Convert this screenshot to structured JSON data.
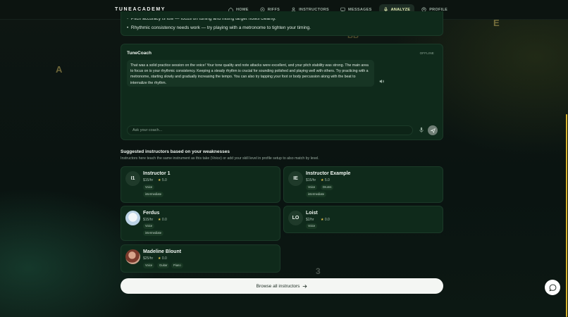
{
  "app": {
    "logo": "TUNEACADEMY"
  },
  "nav": {
    "items": [
      {
        "label": "HOME",
        "icon": "home-icon"
      },
      {
        "label": "RIFFS",
        "icon": "riffs-icon"
      },
      {
        "label": "INSTRUCTORS",
        "icon": "user-icon"
      },
      {
        "label": "MESSAGES",
        "icon": "message-icon"
      },
      {
        "label": "ANALYZE",
        "icon": "mic-icon",
        "active": true
      },
      {
        "label": "PROFILE",
        "icon": "profile-icon"
      }
    ]
  },
  "analysis": {
    "partial_bullet": "Pitch accuracy is low — focus on tuning and hitting target notes cleanly.",
    "bullet2": "Rhythmic consistency needs work — try playing with a metronome to tighten your timing."
  },
  "coach": {
    "title": "TuneCoach",
    "status": "OFFLINE",
    "message": "That was a solid practice session on the voice! Your tone quality and note attacks were excellent, and your pitch stability was strong. The main area to focus on is your rhythmic consistency. Keeping a steady rhythm is crucial for sounding polished and playing well with others. Try practicing with a metronome, starting slowly and gradually increasing the tempo. You can also try tapping your foot or body percussion along with the beat to internalize the rhythm.",
    "input_placeholder": "Ask your coach..."
  },
  "suggestions": {
    "title": "Suggested instructors based on your weaknesses",
    "subtitle": "Instructors here teach the same instrument as this take (Voice) or add your skill level in profile setup to also match by level.",
    "instructors": [
      {
        "initials": "I1",
        "name": "Instructor 1",
        "price": "$15/hr",
        "rating": "5.0",
        "tags": [
          "Voice"
        ],
        "level": "intermediate"
      },
      {
        "initials": "IE",
        "name": "Instructor Example",
        "price": "$15/hr",
        "rating": "5.0",
        "tags": [
          "Voice",
          "Drums"
        ],
        "level": "intermediate"
      },
      {
        "initials": "",
        "name": "Ferdus",
        "price": "$15/hr",
        "rating": "0.0",
        "tags": [
          "Voice"
        ],
        "level": "intermediate"
      },
      {
        "initials": "LO",
        "name": "Loist",
        "price": "$2/hr",
        "rating": "0.0",
        "tags": [
          "Voice"
        ],
        "level": ""
      },
      {
        "initials": "",
        "name": "Madeline Blount",
        "price": "$25/hr",
        "rating": "0.0",
        "tags": [
          "Voice",
          "Guitar",
          "Piano"
        ],
        "level": ""
      }
    ],
    "browse_label": "Browse all instructors"
  },
  "background_letters": [
    "A",
    "E",
    "BB",
    "3"
  ],
  "colors": {
    "accent": "#e6f3b6",
    "card": "#0f2a1b",
    "star": "#e8c54a"
  }
}
